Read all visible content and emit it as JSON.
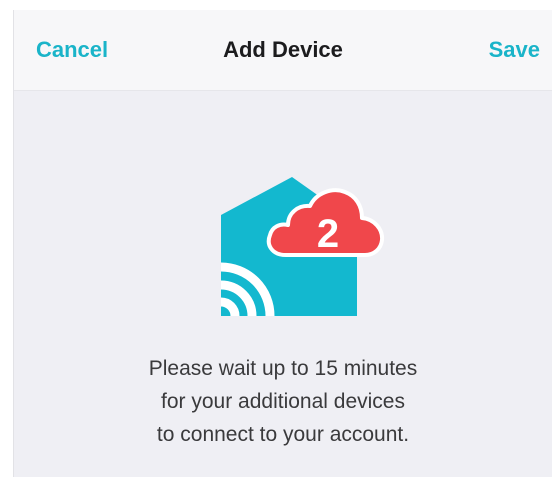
{
  "navbar": {
    "cancel_label": "Cancel",
    "title": "Add Device",
    "save_label": "Save"
  },
  "illustration": {
    "house_icon": "smart-home-icon",
    "cloud_icon": "cloud-badge-icon",
    "badge_count": "2",
    "colors": {
      "house": "#13b8cf",
      "cloud": "#f0474b",
      "badge_text": "#ffffff"
    }
  },
  "message": {
    "line1": "Please wait up to 15 minutes",
    "line2": "for your additional devices",
    "line3": "to connect to your account."
  },
  "colors": {
    "accent": "#1ab4c9",
    "background": "#efeff4",
    "navbar": "#f7f7f9"
  }
}
